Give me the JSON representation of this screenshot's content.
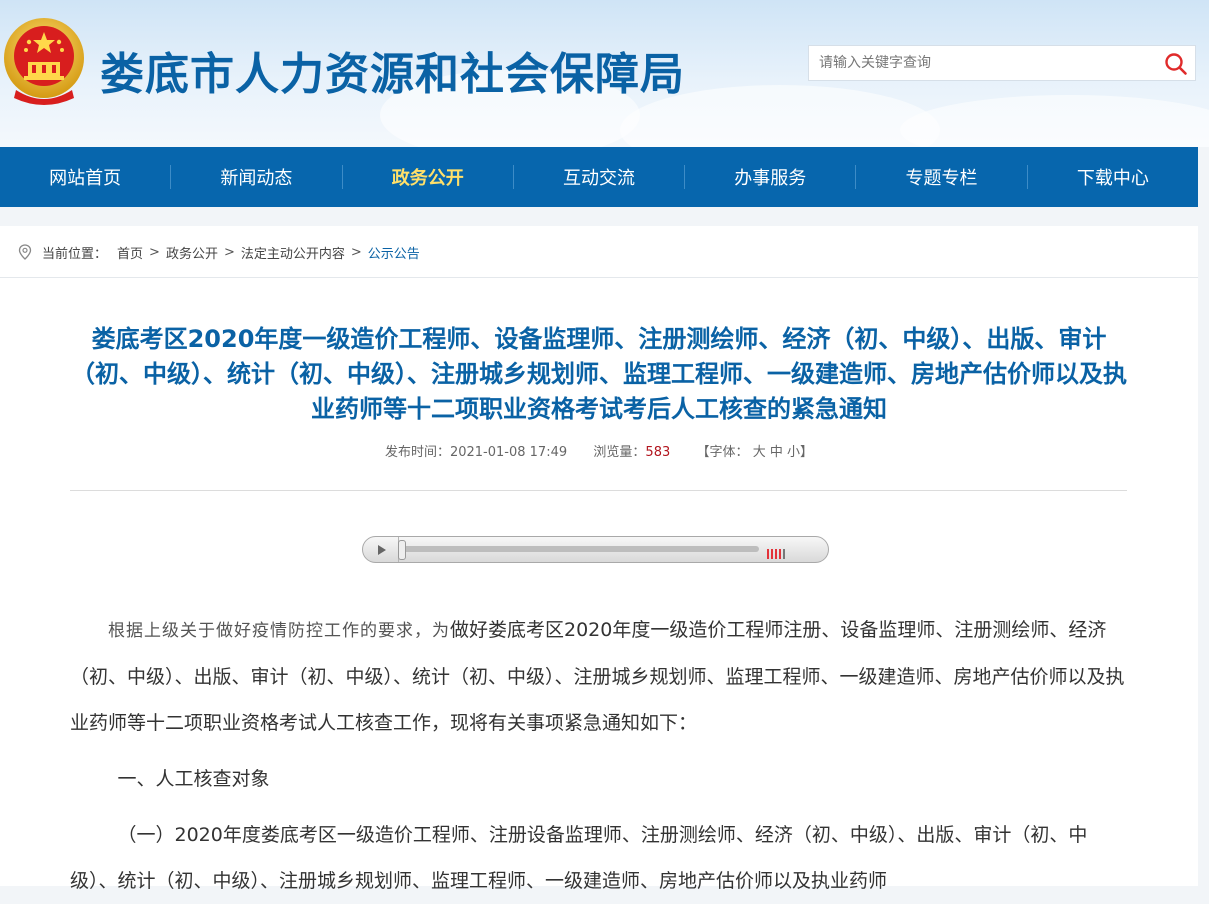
{
  "header": {
    "site_title": "娄底市人力资源和社会保障局",
    "search_placeholder": "请输入关键字查询"
  },
  "nav": {
    "items": [
      {
        "label": "网站首页",
        "active": false
      },
      {
        "label": "新闻动态",
        "active": false
      },
      {
        "label": "政务公开",
        "active": true
      },
      {
        "label": "互动交流",
        "active": false
      },
      {
        "label": "办事服务",
        "active": false
      },
      {
        "label": "专题专栏",
        "active": false
      },
      {
        "label": "下载中心",
        "active": false
      }
    ]
  },
  "breadcrumb": {
    "prefix": "当前位置：",
    "items": [
      "首页",
      "政务公开",
      "法定主动公开内容",
      "公示公告"
    ],
    "separator": ">"
  },
  "article": {
    "title": "娄底考区2020年度一级造价工程师、设备监理师、注册测绘师、经济（初、中级）、出版、审计（初、中级）、统计（初、中级）、注册城乡规划师、监理工程师、一级建造师、房地产估价师以及执业药师等十二项职业资格考试考后人工核查的紧急通知",
    "publish_label": "发布时间：",
    "publish_time": "2021-01-08 17:49",
    "views_label": "浏览量：",
    "views": "583",
    "font_label_open": "【字体：",
    "font_large": "大",
    "font_medium": "中",
    "font_small": "小",
    "font_label_close": "】",
    "p1_lead": "根据上级关于做好疫情防控工作的要求，为",
    "p1_rest": "做好娄底考区2020年度一级造价工程师注册、设备监理师、注册测绘师、经济（初、中级）、出版、审计（初、中级）、统计（初、中级）、注册城乡规划师、监理工程师、一级建造师、房地产估价师以及执业药师等十二项职业资格考试人工核查工作，现将有关事项紧急通知如下：",
    "section1": "一、人工核查对象",
    "p3": "（一）2020年度娄底考区一级造价工程师、注册设备监理师、注册测绘师、经济（初、中级）、出版、审计（初、中级）、统计（初、中级）、注册城乡规划师、监理工程师、一级建造师、房地产估价师以及执业药师"
  },
  "player": {
    "progress": 0.0
  },
  "colors": {
    "brand_blue": "#0766ad",
    "title_blue": "#0a62a5",
    "nav_active": "#ffe06a",
    "views_red": "#b2151e"
  },
  "icons": {
    "emblem": "national-emblem-icon",
    "search": "search-icon",
    "location": "location-pin-icon"
  }
}
